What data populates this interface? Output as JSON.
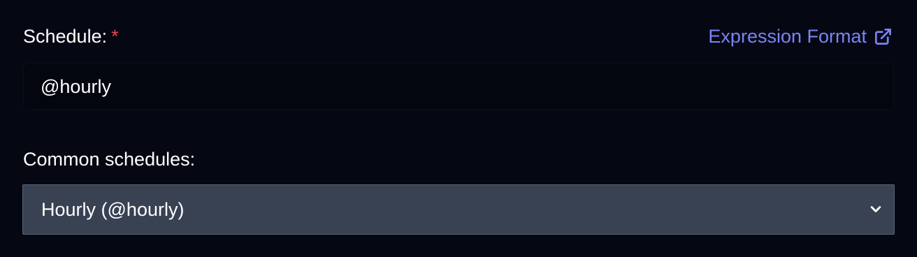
{
  "schedule": {
    "label": "Schedule:",
    "required_marker": "*",
    "value": "@hourly",
    "help_link": {
      "label": "Expression Format",
      "icon": "external-link-icon"
    }
  },
  "common_schedules": {
    "label": "Common schedules:",
    "selected": "Hourly (@hourly)",
    "icon": "chevron-down-icon"
  },
  "colors": {
    "background": "#050813",
    "link": "#7c83f4",
    "required": "#ef4444",
    "select_bg": "#384253"
  }
}
